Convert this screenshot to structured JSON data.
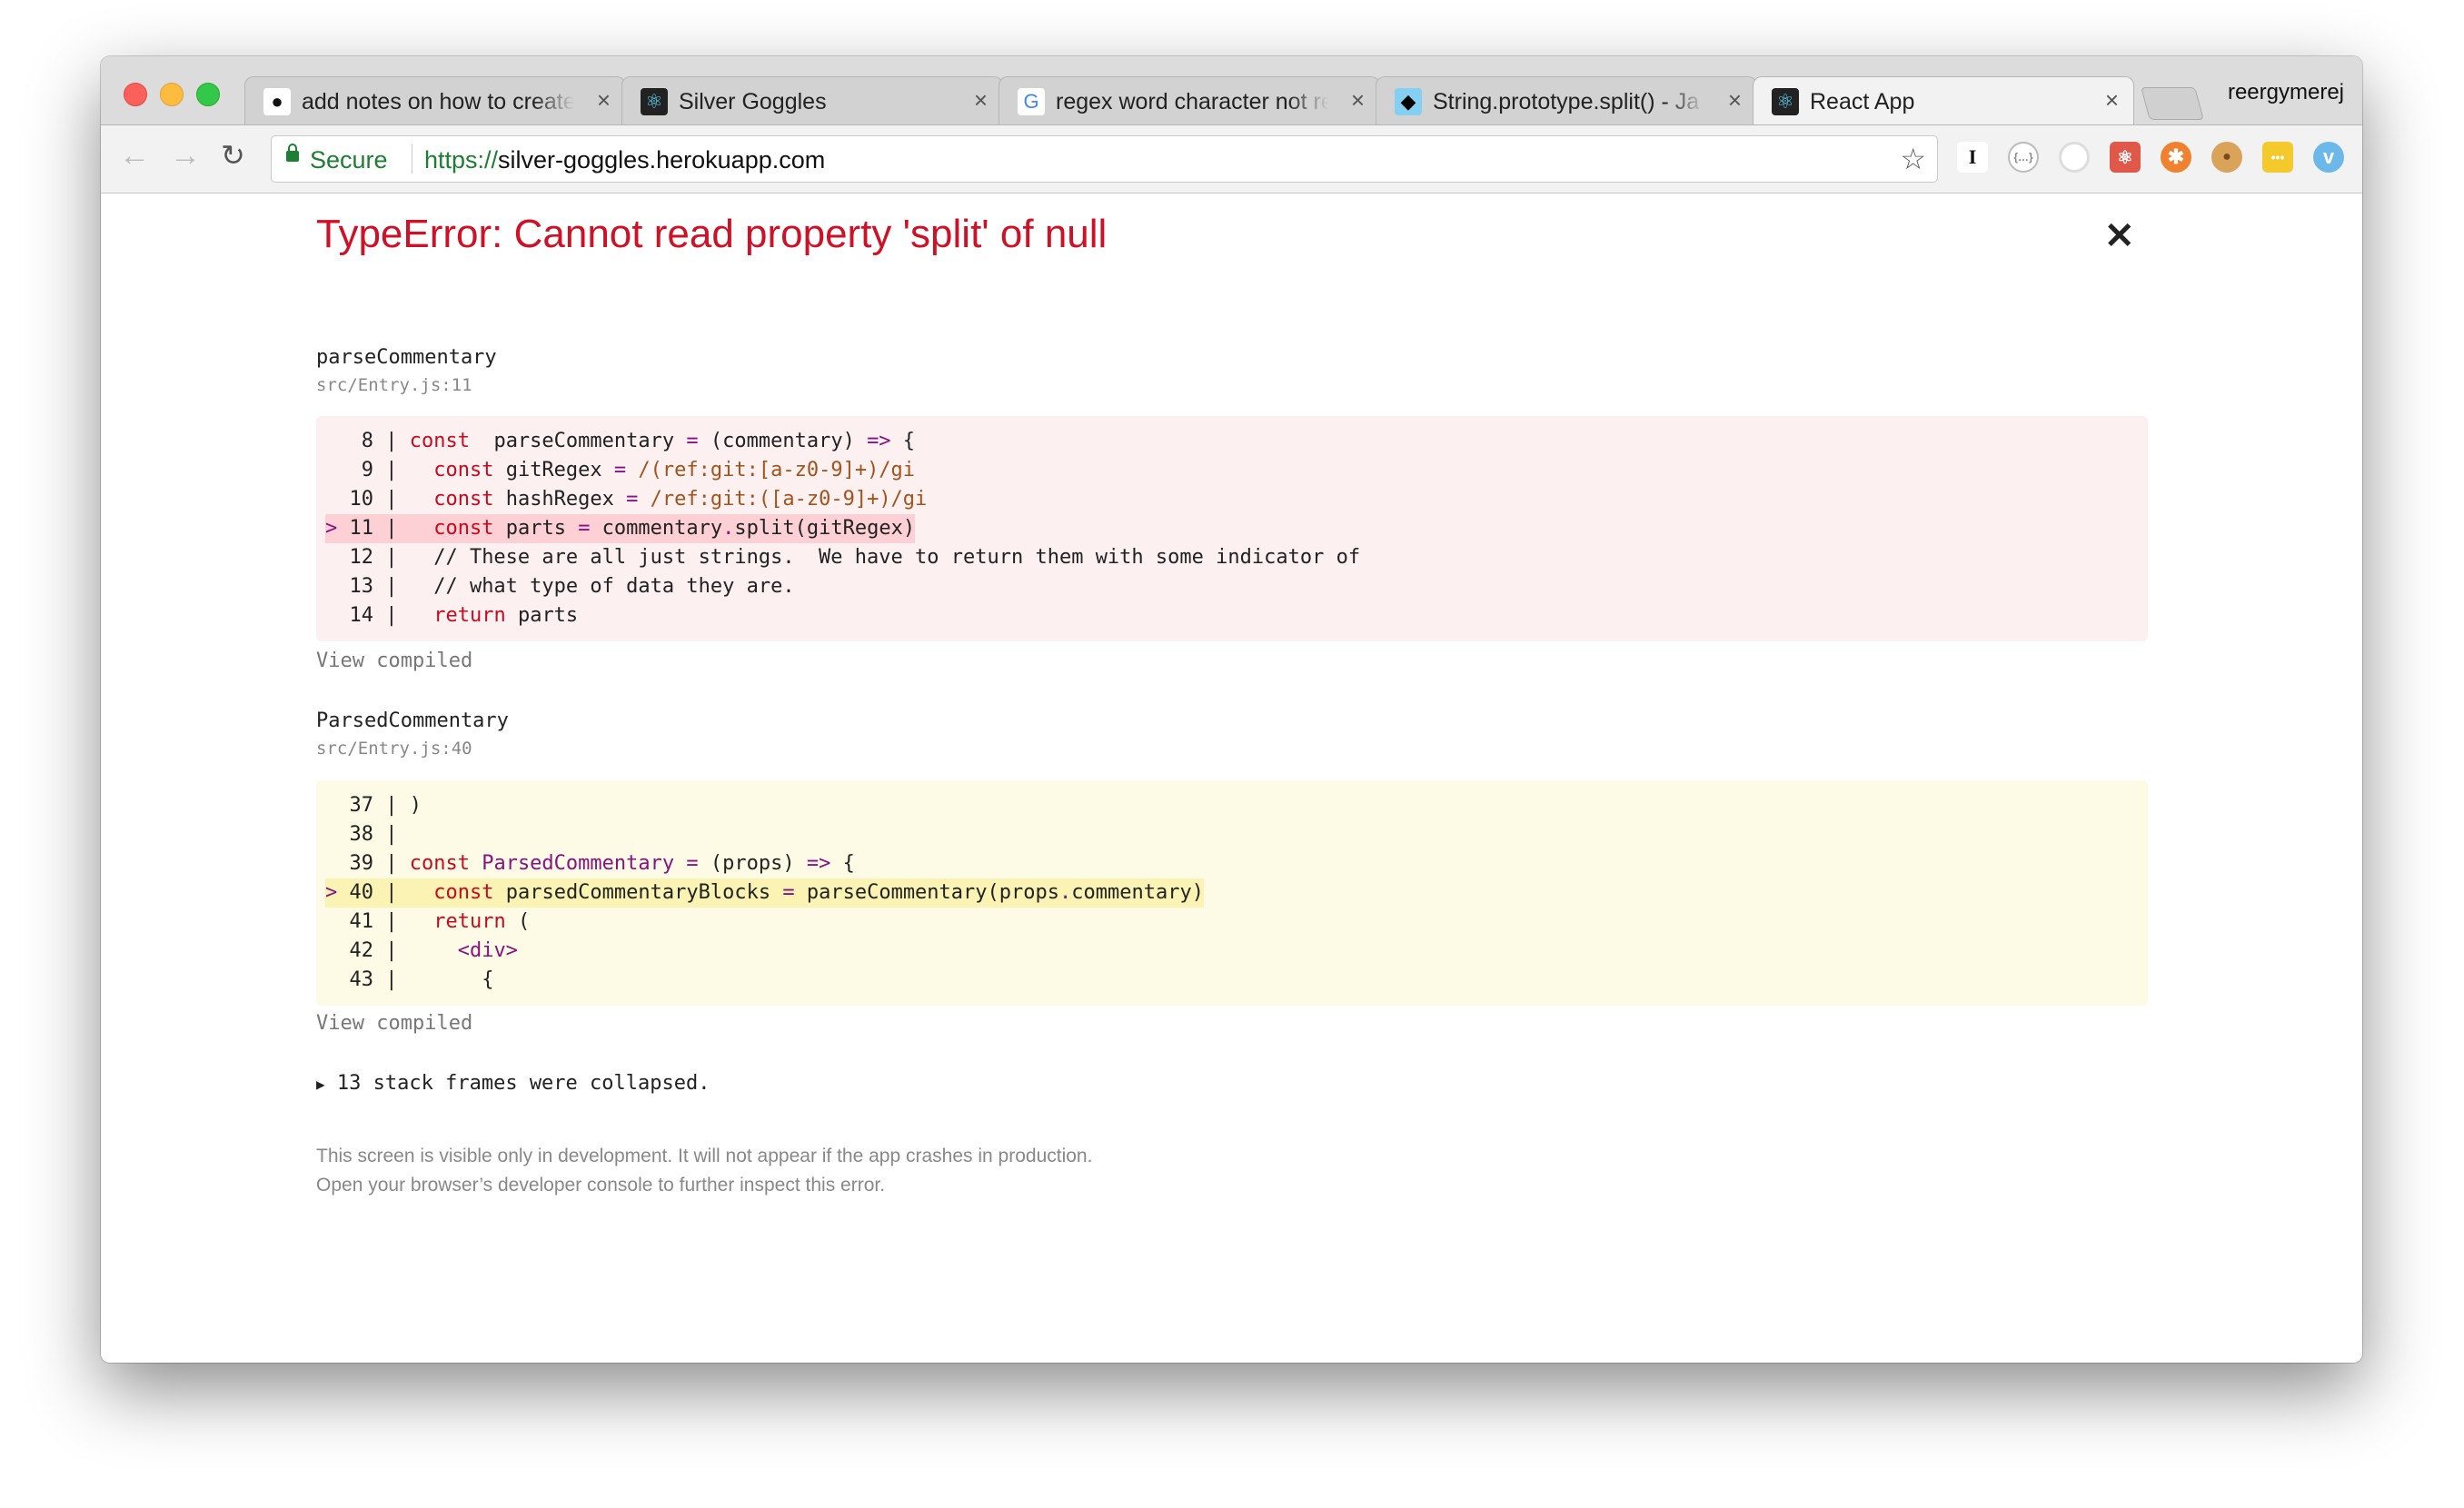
{
  "browser": {
    "tabs": [
      {
        "title": "add notes on how to create",
        "icon": "github-icon",
        "active": false
      },
      {
        "title": "Silver Goggles",
        "icon": "react-icon",
        "active": false
      },
      {
        "title": "regex word character not re",
        "icon": "google-icon",
        "active": false
      },
      {
        "title": "String.prototype.split() - Ja",
        "icon": "mdn-dino-icon",
        "active": false
      },
      {
        "title": "React App",
        "icon": "react-icon",
        "active": true
      }
    ],
    "close_glyph": "×",
    "profile_name": "reergymerej",
    "secure_label": "Secure",
    "url_scheme": "https://",
    "url_host": "silver-goggles.herokuapp.com"
  },
  "overlay": {
    "error_title": "TypeError: Cannot read property 'split' of null",
    "close_glyph": "✕",
    "frames": [
      {
        "function": "parseCommentary",
        "location": "src/Entry.js:11",
        "view_compiled": "View compiled",
        "lines": [
          {
            "gutter": "   8 | ",
            "hl": false,
            "tokens": [
              [
                "keyword",
                "const"
              ],
              [
                "",
                "  parseCommentary "
              ],
              [
                "op",
                "="
              ],
              [
                "",
                " (commentary) "
              ],
              [
                "arrow",
                "=>"
              ],
              [
                "",
                " {"
              ]
            ]
          },
          {
            "gutter": "   9 | ",
            "hl": false,
            "tokens": [
              [
                "",
                "  "
              ],
              [
                "keyword",
                "const"
              ],
              [
                "",
                " gitRegex "
              ],
              [
                "op",
                "="
              ],
              [
                "",
                " "
              ],
              [
                "regex",
                "/(ref:git:[a-z0-9]+)/gi"
              ]
            ]
          },
          {
            "gutter": "  10 | ",
            "hl": false,
            "tokens": [
              [
                "",
                "  "
              ],
              [
                "keyword",
                "const"
              ],
              [
                "",
                " hashRegex "
              ],
              [
                "op",
                "="
              ],
              [
                "",
                " "
              ],
              [
                "regex",
                "/ref:git:([a-z0-9]+)/gi"
              ]
            ]
          },
          {
            "gutter": "> 11 | ",
            "hl": true,
            "tokens": [
              [
                "",
                "  "
              ],
              [
                "keyword",
                "const"
              ],
              [
                "",
                " parts "
              ],
              [
                "op",
                "="
              ],
              [
                "",
                " commentary"
              ],
              [
                "op",
                "."
              ],
              [
                "",
                "split(gitRegex)"
              ]
            ]
          },
          {
            "gutter": "  12 | ",
            "hl": false,
            "tokens": [
              [
                "",
                "  // These are all just strings.  We have to return them with some indicator of"
              ]
            ]
          },
          {
            "gutter": "  13 | ",
            "hl": false,
            "tokens": [
              [
                "",
                "  // what type of data they are."
              ]
            ]
          },
          {
            "gutter": "  14 | ",
            "hl": false,
            "tokens": [
              [
                "",
                "  "
              ],
              [
                "keyword",
                "return"
              ],
              [
                "",
                " parts"
              ]
            ]
          }
        ]
      },
      {
        "function": "ParsedCommentary",
        "location": "src/Entry.js:40",
        "view_compiled": "View compiled",
        "lines": [
          {
            "gutter": "  37 | ",
            "hl": false,
            "tokens": [
              [
                "",
                ")"
              ]
            ]
          },
          {
            "gutter": "  38 | ",
            "hl": false,
            "tokens": [
              [
                "",
                ""
              ]
            ]
          },
          {
            "gutter": "  39 | ",
            "hl": false,
            "tokens": [
              [
                "keyword",
                "const"
              ],
              [
                "",
                " "
              ],
              [
                "name",
                "ParsedCommentary"
              ],
              [
                "",
                " "
              ],
              [
                "op",
                "="
              ],
              [
                "",
                " (props) "
              ],
              [
                "arrow",
                "=>"
              ],
              [
                "",
                " {"
              ]
            ]
          },
          {
            "gutter": "> 40 | ",
            "hl": true,
            "tokens": [
              [
                "",
                "  "
              ],
              [
                "keyword",
                "const"
              ],
              [
                "",
                " parsedCommentaryBlocks "
              ],
              [
                "op",
                "="
              ],
              [
                "",
                " parseCommentary(props"
              ],
              [
                "op",
                "."
              ],
              [
                "",
                "commentary)"
              ]
            ]
          },
          {
            "gutter": "  41 | ",
            "hl": false,
            "tokens": [
              [
                "",
                "  "
              ],
              [
                "keyword",
                "return"
              ],
              [
                "",
                " ("
              ]
            ]
          },
          {
            "gutter": "  42 | ",
            "hl": false,
            "tokens": [
              [
                "",
                "    "
              ],
              [
                "tag",
                "<div>"
              ]
            ]
          },
          {
            "gutter": "  43 | ",
            "hl": false,
            "tokens": [
              [
                "",
                "      {"
              ]
            ]
          }
        ]
      }
    ],
    "collapsed_toggle": "▶",
    "collapsed_text": "13 stack frames were collapsed.",
    "footer_line1": "This screen is visible only in development. It will not appear if the app crashes in production.",
    "footer_line2": "Open your browser’s developer console to further inspect this error."
  },
  "colors": {
    "error_red": "#ce1126",
    "secure_green": "#1e7e34"
  }
}
